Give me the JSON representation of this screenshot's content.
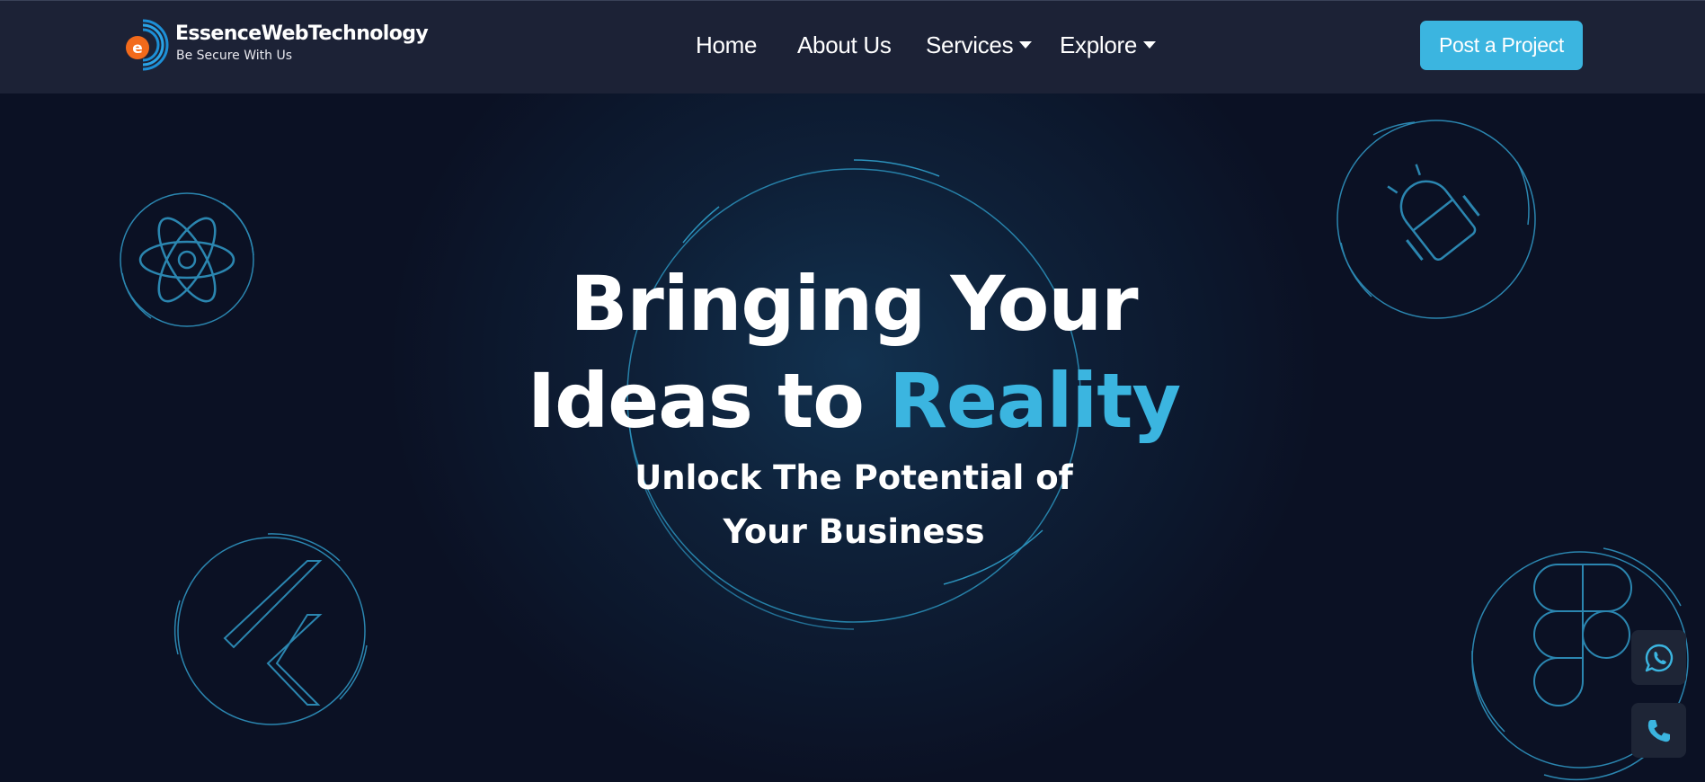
{
  "brand": {
    "logo_letter": "e",
    "name": "EssenceWebTechnology",
    "tagline": "Be Secure With Us",
    "colors": {
      "orange": "#f26a1b",
      "blue": "#1d8fd6",
      "accent": "#3bb5e0"
    }
  },
  "nav": {
    "items": [
      {
        "label": "Home",
        "dropdown": false
      },
      {
        "label": "About Us",
        "dropdown": false
      },
      {
        "label": "Services",
        "dropdown": true
      },
      {
        "label": "Explore",
        "dropdown": true
      }
    ],
    "cta_label": "Post a Project"
  },
  "hero": {
    "headline_line1": "Bringing Your",
    "headline_line2_prefix": "Ideas to",
    "headline_highlight": "Reality",
    "subtitle_line1": "Unlock The Potential of",
    "subtitle_line2": "Your Business",
    "decorative_icons": [
      "react-icon",
      "android-icon",
      "flutter-icon",
      "figma-icon"
    ]
  },
  "floating_actions": [
    {
      "icon": "whatsapp-icon"
    },
    {
      "icon": "phone-icon"
    }
  ]
}
